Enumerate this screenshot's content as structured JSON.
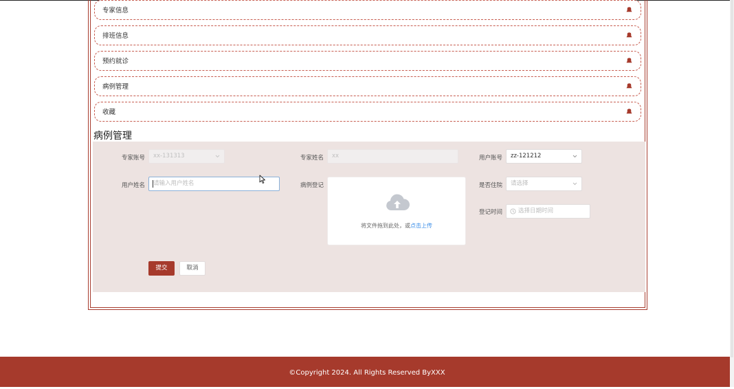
{
  "menu": {
    "items": [
      {
        "label": "专家信息"
      },
      {
        "label": "排班信息"
      },
      {
        "label": "预约就诊"
      },
      {
        "label": "病例管理"
      },
      {
        "label": "收藏"
      }
    ]
  },
  "section": {
    "title": "病例管理"
  },
  "form": {
    "expert_account": {
      "label": "专家账号",
      "value": "xx-131313"
    },
    "expert_name": {
      "label": "专家姓名",
      "value": "xx"
    },
    "user_account": {
      "label": "用户账号",
      "value": "zz-121212"
    },
    "user_name": {
      "label": "用户姓名",
      "placeholder": "请输入用户姓名"
    },
    "case_record": {
      "label": "病例登记",
      "upload_hint": "将文件拖到此处，或",
      "upload_link": "点击上传"
    },
    "hospitalized": {
      "label": "是否住院",
      "placeholder": "请选择"
    },
    "register_time": {
      "label": "登记时间",
      "placeholder": "选择日期时间"
    },
    "submit_label": "提交",
    "cancel_label": "取消"
  },
  "footer": {
    "text": "©Copyright 2024. All Rights Reserved ByXXX"
  },
  "colors": {
    "brand": "#a63a2c",
    "panel": "#ede3e1",
    "link": "#3b8ee8"
  },
  "icons": [
    "bell-icon",
    "chevron-down-icon",
    "clock-icon",
    "upload-cloud-icon",
    "mouse-cursor-icon"
  ]
}
